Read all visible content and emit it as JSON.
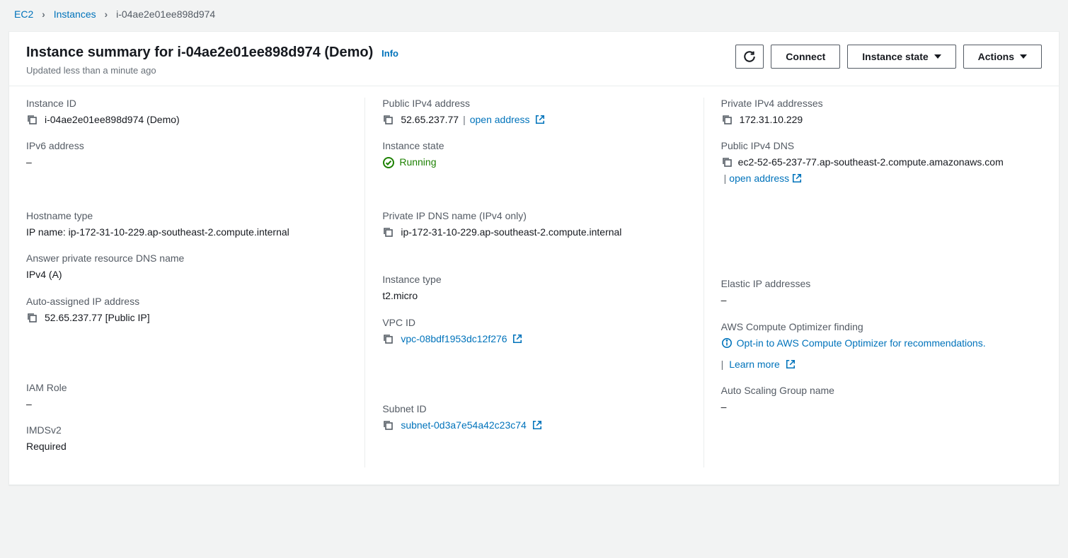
{
  "breadcrumb": {
    "root": "EC2",
    "section": "Instances",
    "current": "i-04ae2e01ee898d974"
  },
  "header": {
    "title": "Instance summary for i-04ae2e01ee898d974 (Demo)",
    "info": "Info",
    "subtitle": "Updated less than a minute ago",
    "connect": "Connect",
    "instance_state": "Instance state",
    "actions": "Actions"
  },
  "fields": {
    "instance_id": {
      "label": "Instance ID",
      "value": "i-04ae2e01ee898d974 (Demo)"
    },
    "public_ipv4": {
      "label": "Public IPv4 address",
      "value": "52.65.237.77",
      "open": "open address"
    },
    "private_ipv4": {
      "label": "Private IPv4 addresses",
      "value": "172.31.10.229"
    },
    "ipv6": {
      "label": "IPv6 address",
      "value": "–"
    },
    "instance_state": {
      "label": "Instance state",
      "value": "Running"
    },
    "public_dns": {
      "label": "Public IPv4 DNS",
      "value": "ec2-52-65-237-77.ap-southeast-2.compute.amazonaws.com",
      "open": "open address"
    },
    "hostname_type": {
      "label": "Hostname type",
      "value": "IP name: ip-172-31-10-229.ap-southeast-2.compute.internal"
    },
    "private_dns": {
      "label": "Private IP DNS name (IPv4 only)",
      "value": "ip-172-31-10-229.ap-southeast-2.compute.internal"
    },
    "answer_dns": {
      "label": "Answer private resource DNS name",
      "value": "IPv4 (A)"
    },
    "instance_type": {
      "label": "Instance type",
      "value": "t2.micro"
    },
    "elastic_ip": {
      "label": "Elastic IP addresses",
      "value": "–"
    },
    "auto_ip": {
      "label": "Auto-assigned IP address",
      "value": "52.65.237.77 [Public IP]"
    },
    "vpc": {
      "label": "VPC ID",
      "value": "vpc-08bdf1953dc12f276"
    },
    "optimizer": {
      "label": "AWS Compute Optimizer finding",
      "value": "Opt-in to AWS Compute Optimizer for recommendations.",
      "learn": "Learn more"
    },
    "iam": {
      "label": "IAM Role",
      "value": "–"
    },
    "subnet": {
      "label": "Subnet ID",
      "value": "subnet-0d3a7e54a42c23c74"
    },
    "asg": {
      "label": "Auto Scaling Group name",
      "value": "–"
    },
    "imdsv2": {
      "label": "IMDSv2",
      "value": "Required"
    }
  }
}
